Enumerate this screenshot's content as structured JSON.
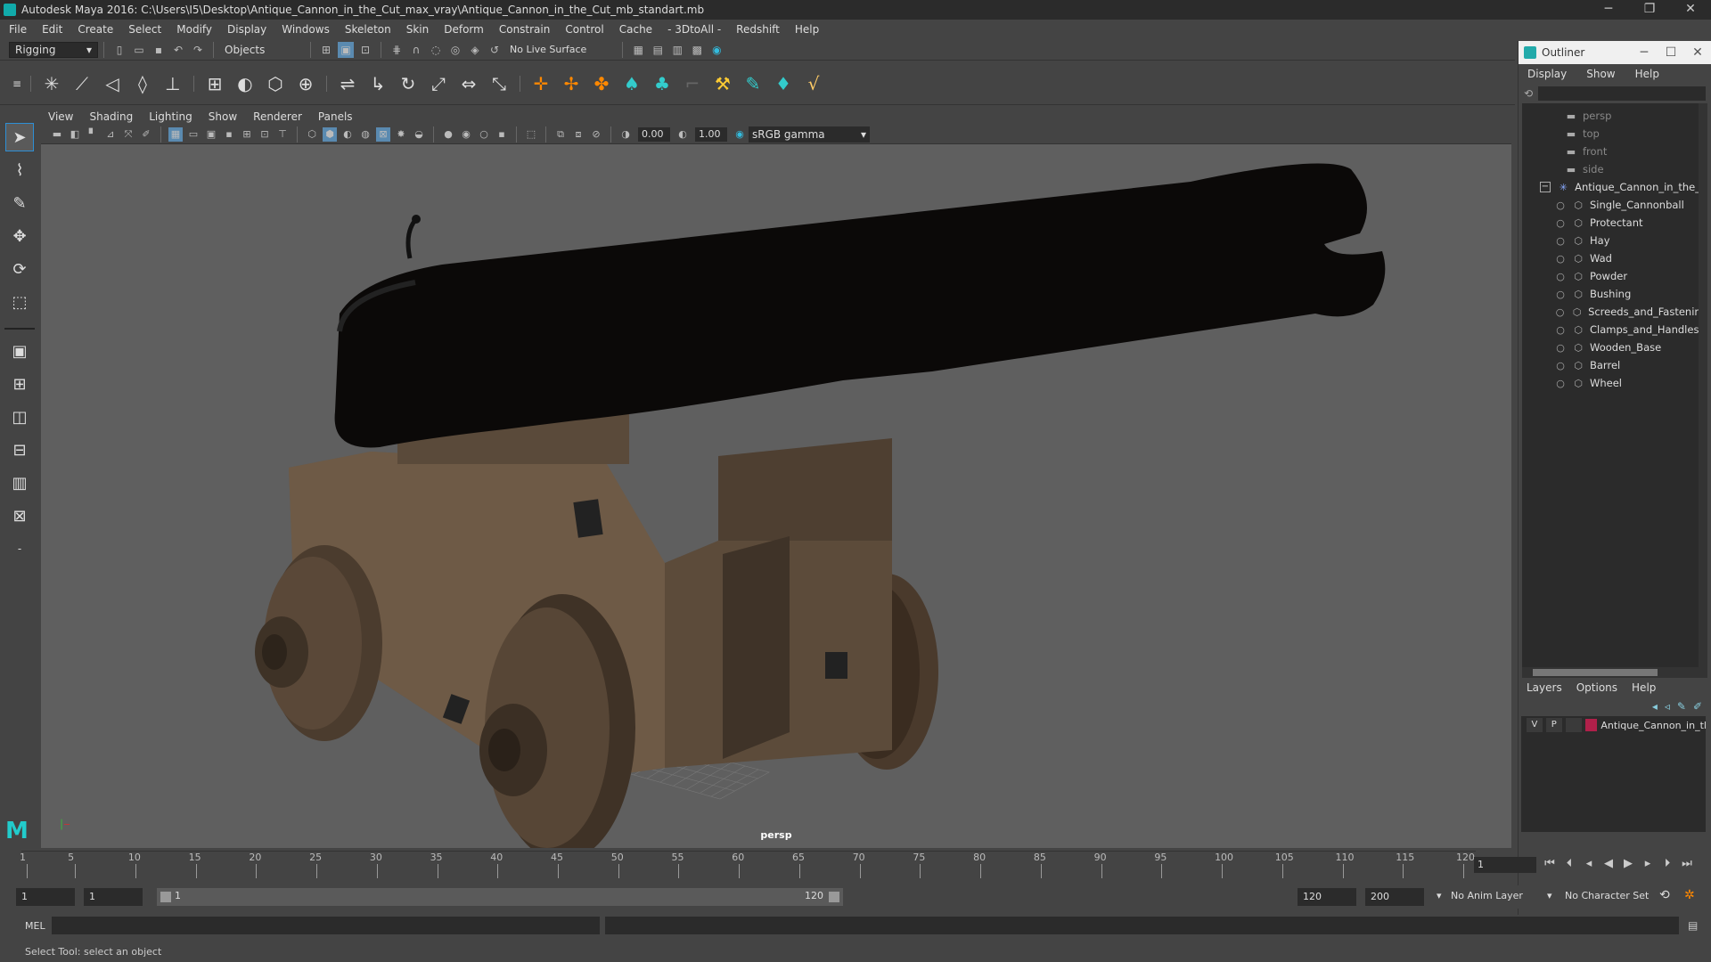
{
  "window": {
    "title": "Autodesk Maya 2016: C:\\Users\\I5\\Desktop\\Antique_Cannon_in_the_Cut_max_vray\\Antique_Cannon_in_the_Cut_mb_standart.mb",
    "minimize": "─",
    "restore": "❐",
    "close": "✕"
  },
  "menubar": [
    "File",
    "Edit",
    "Create",
    "Select",
    "Modify",
    "Display",
    "Windows",
    "Skeleton",
    "Skin",
    "Deform",
    "Constrain",
    "Control",
    "Cache",
    "- 3DtoAll -",
    "Redshift",
    "Help"
  ],
  "statusline": {
    "menuset": "Rigging",
    "selection_mode": "Objects",
    "live_surface": "No Live Surface"
  },
  "viewport": {
    "menu": [
      "View",
      "Shading",
      "Lighting",
      "Show",
      "Renderer",
      "Panels"
    ],
    "exposure": "0.00",
    "gamma_value": "1.00",
    "color_space": "sRGB gamma",
    "camera_label": "persp"
  },
  "outliner": {
    "title": "Outliner",
    "menu": [
      "Display",
      "Show",
      "Help"
    ],
    "cameras": [
      "persp",
      "top",
      "front",
      "side"
    ],
    "root": "Antique_Cannon_in_the_C",
    "children": [
      "Single_Cannonball",
      "Protectant",
      "Hay",
      "Wad",
      "Powder",
      "Bushing",
      "Screeds_and_Fastening",
      "Clamps_and_Handles",
      "Wooden_Base",
      "Barrel",
      "Wheel"
    ]
  },
  "layers": {
    "menu": [
      "Layers",
      "Options",
      "Help"
    ],
    "rows": [
      {
        "v": "V",
        "p": "P",
        "name": "Antique_Cannon_in_tl",
        "color": "#b0204a"
      }
    ]
  },
  "timeline": {
    "ticks": [
      1,
      5,
      10,
      15,
      20,
      25,
      30,
      35,
      40,
      45,
      50,
      55,
      60,
      65,
      70,
      75,
      80,
      85,
      90,
      95,
      100,
      105,
      110,
      115,
      120
    ],
    "current_frame": "1"
  },
  "range": {
    "start": "1",
    "playback_start": "1",
    "range_start_label": "1",
    "range_end_label": "120",
    "playback_end": "120",
    "end": "200",
    "anim_layer": "No Anim Layer",
    "character_set": "No Character Set"
  },
  "command": {
    "label": "MEL"
  },
  "help_line": "Select Tool: select an object"
}
